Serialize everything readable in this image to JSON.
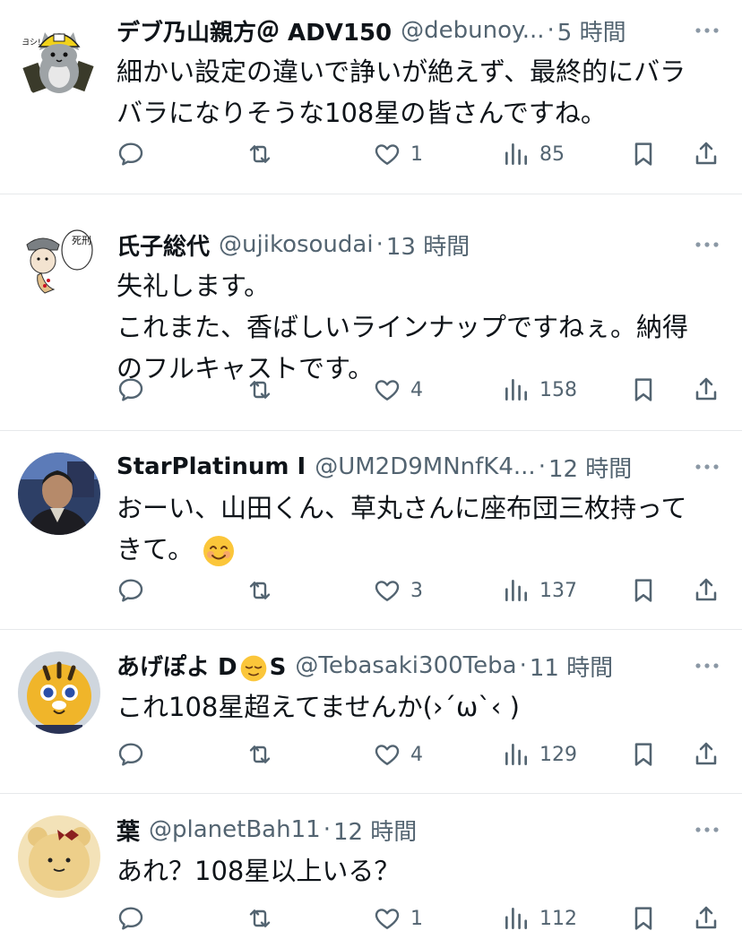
{
  "tweets": [
    {
      "name": "デブ乃山親方＠ ADV150",
      "handle": "@debunoy...",
      "time": "5 時間",
      "lines": [
        "細かい設定の違いで諍いが絶えず、最終的にバラ",
        "バラになりそうな108星の皆さんですね。"
      ],
      "likes": "1",
      "views": "85",
      "avatar_icon": "cat-helmet-avatar-icon"
    },
    {
      "name": "氏子総代",
      "handle": "@ujikosoudai",
      "time": "13 時間",
      "lines": [
        "失礼します。",
        "これまた、香ばしいラインナップですねぇ。納得",
        "のフルキャストです。"
      ],
      "likes": "4",
      "views": "158",
      "avatar_icon": "manga-character-avatar-icon",
      "avatar_text": "死刑"
    },
    {
      "name": "StarPlatinum I",
      "handle": "@UM2D9MNnfK4...",
      "time": "12 時間",
      "line1": "おーい、山田くん、草丸さんに座布団三枚持って",
      "line2": "きて。",
      "likes": "3",
      "views": "137",
      "avatar_icon": "man-photo-avatar-icon"
    },
    {
      "name_before": "あげぽよ D",
      "name_after": "S",
      "handle": "@Tebasaki300Teba",
      "time": "11 時間",
      "lines": [
        "これ108星超えてませんか(›´ω`‹ )"
      ],
      "likes": "4",
      "views": "129",
      "avatar_icon": "tiger-mascot-avatar-icon"
    },
    {
      "name": "葉",
      "handle": "@planetBah11",
      "time": "12 時間",
      "lines": [
        "あれ？108星以上いる？"
      ],
      "likes": "1",
      "views": "112",
      "avatar_icon": "bear-ribbon-avatar-icon"
    }
  ],
  "dot_sep": "·",
  "colors": {
    "text": "#0f1419",
    "secondary": "#536471",
    "divider": "#e6e9eb"
  }
}
